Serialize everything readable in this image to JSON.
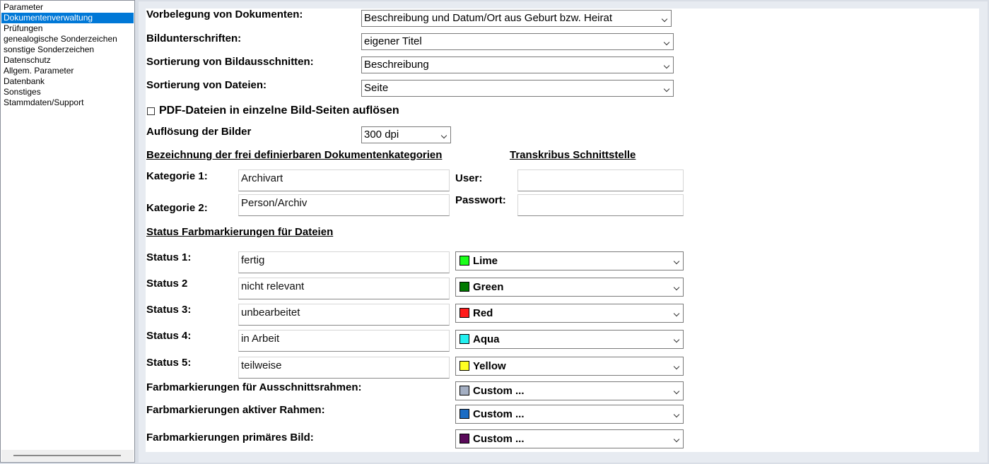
{
  "sidebar": {
    "items": [
      {
        "label": "Parameter"
      },
      {
        "label": "Dokumentenverwaltung",
        "active": true
      },
      {
        "label": "Prüfungen"
      },
      {
        "label": "genealogische Sonderzeichen"
      },
      {
        "label": "sonstige Sonderzeichen"
      },
      {
        "label": "Datenschutz"
      },
      {
        "label": "Allgem. Parameter"
      },
      {
        "label": "Datenbank"
      },
      {
        "label": "Sonstiges"
      },
      {
        "label": "Stammdaten/Support"
      }
    ]
  },
  "form": {
    "vorbelegung": {
      "label": "Vorbelegung von Dokumenten:",
      "value": "Beschreibung und Datum/Ort aus Geburt bzw. Heirat"
    },
    "bildunterschriften": {
      "label": "Bildunterschriften:",
      "value": "eigener Titel"
    },
    "sort_ausschnitte": {
      "label": "Sortierung von Bildausschnitten:",
      "value": "Beschreibung"
    },
    "sort_dateien": {
      "label": "Sortierung von Dateien:",
      "value": "Seite"
    },
    "pdf": {
      "label": "PDF-Dateien in einzelne Bild-Seiten auflösen",
      "checked": false
    },
    "aufloesung": {
      "label": "Auflösung der Bilder",
      "value": "300 dpi"
    },
    "kategorien": {
      "heading": "Bezeichnung der frei definierbaren Dokumentenkategorien",
      "kat1": {
        "label": "Kategorie 1:",
        "value": "Archivart"
      },
      "kat2": {
        "label": "Kategorie 2:",
        "value": "Person/Archiv"
      }
    },
    "transkribus": {
      "heading": "Transkribus Schnittstelle",
      "user": {
        "label": "User:",
        "value": ""
      },
      "passwort": {
        "label": "Passwort:",
        "value": ""
      }
    },
    "status": {
      "heading": "Status Farbmarkierungen für Dateien",
      "rows": [
        {
          "label": "Status 1:",
          "text": "fertig",
          "color_name": "Lime",
          "color": "#1aff1a"
        },
        {
          "label": "Status 2",
          "text": "nicht relevant",
          "color_name": "Green",
          "color": "#007a00"
        },
        {
          "label": "Status 3:",
          "text": "unbearbeitet",
          "color_name": "Red",
          "color": "#ff1a1a"
        },
        {
          "label": "Status 4:",
          "text": "in Arbeit",
          "color_name": "Aqua",
          "color": "#22f0f0"
        },
        {
          "label": "Status 5:",
          "text": "teilweise",
          "color_name": "Yellow",
          "color": "#ffff22"
        }
      ]
    },
    "markierungen": [
      {
        "label": "Farbmarkierungen für Ausschnittsrahmen:",
        "color_name": "Custom ...",
        "color": "#a3aec2"
      },
      {
        "label": "Farbmarkierungen aktiver Rahmen:",
        "color_name": "Custom ...",
        "color": "#1a6cc4"
      },
      {
        "label": "Farbmarkierungen primäres Bild:",
        "color_name": "Custom ...",
        "color": "#5a0a5a"
      }
    ]
  }
}
